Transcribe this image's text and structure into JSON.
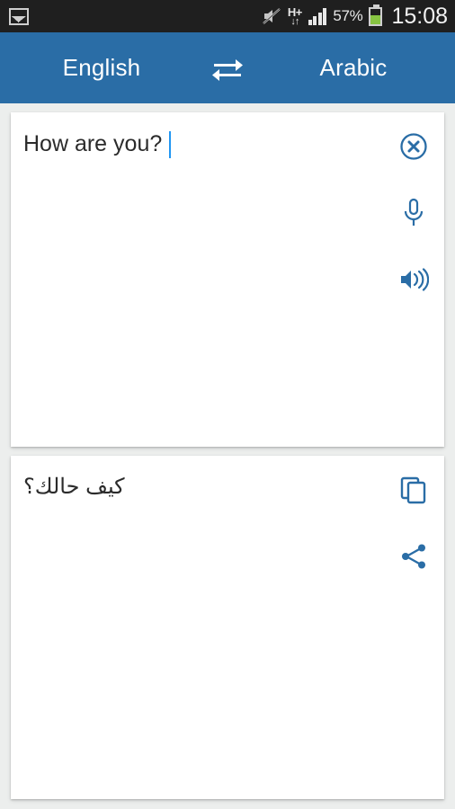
{
  "statusbar": {
    "notification_icon": "photo-icon",
    "icons": [
      "mute-icon",
      "hplus-network-icon",
      "signal-icon"
    ],
    "network_label": "H+",
    "network_arrows": "↓↑",
    "battery_percent": "57%",
    "battery_level": 57,
    "clock": "15:08",
    "background_color": "#1f1f1f"
  },
  "header": {
    "source_language": "English",
    "target_language": "Arabic",
    "swap_icon": "swap-horizontal-icon",
    "background_color": "#2a6da6",
    "text_color": "#ffffff"
  },
  "input_card": {
    "text": "How are you?",
    "has_caret": true,
    "caret_color": "#2196f3",
    "actions": [
      {
        "name": "clear-button",
        "icon": "close-circle-icon",
        "label": "Clear"
      },
      {
        "name": "microphone-button",
        "icon": "microphone-icon",
        "label": "Voice input"
      },
      {
        "name": "speak-button",
        "icon": "speaker-icon",
        "label": "Listen"
      }
    ]
  },
  "output_card": {
    "text": "كيف حالك؟",
    "direction": "rtl",
    "actions": [
      {
        "name": "copy-button",
        "icon": "copy-icon",
        "label": "Copy"
      },
      {
        "name": "share-button",
        "icon": "share-icon",
        "label": "Share"
      }
    ]
  },
  "theme": {
    "accent": "#2a6da6",
    "page_background": "#eceeed",
    "card_background": "#ffffff",
    "text_color": "#2b2b2b"
  }
}
